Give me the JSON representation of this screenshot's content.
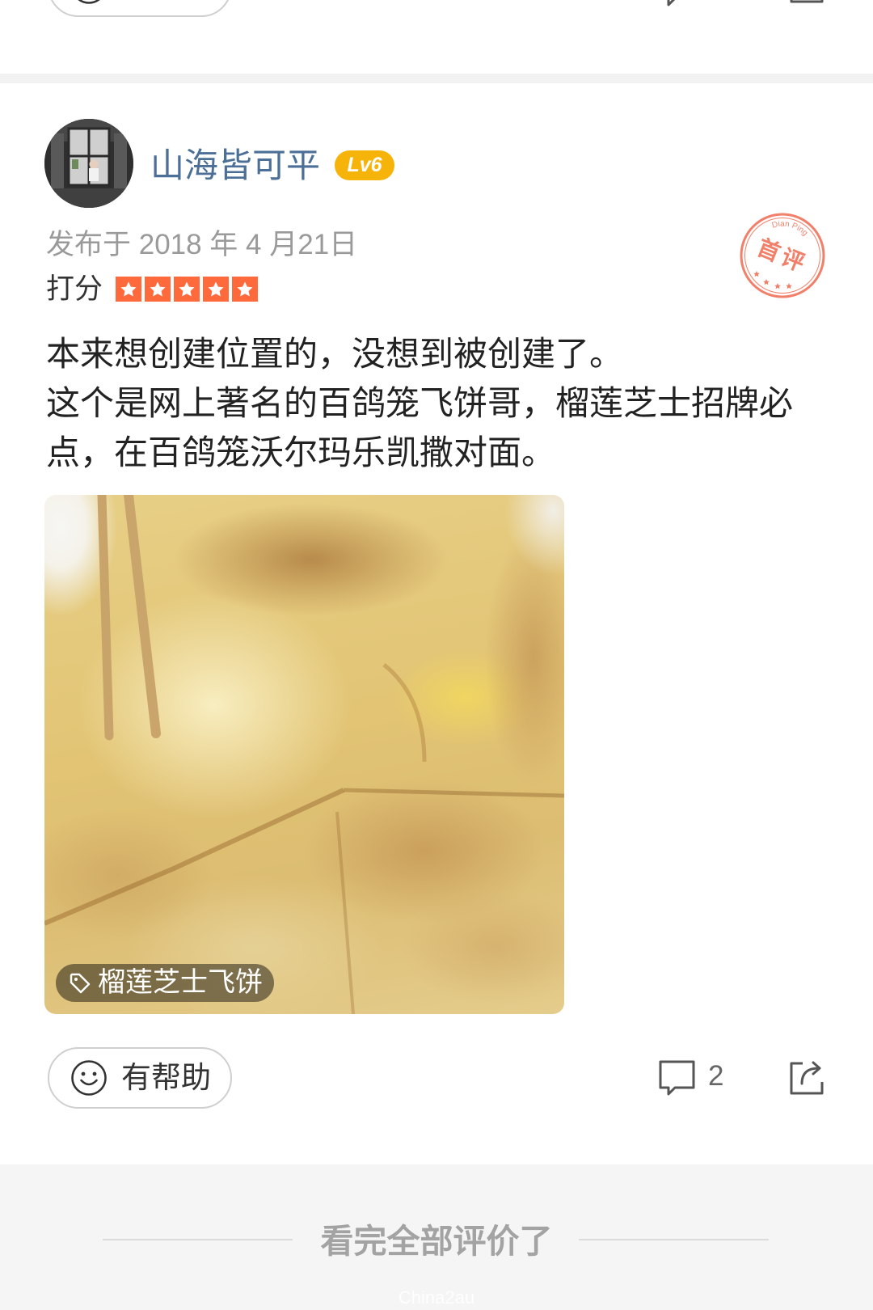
{
  "previous_review": {
    "actions": {
      "helpful_icon": "smiley-icon",
      "comment_icon": "comment-icon",
      "share_icon": "share-icon"
    }
  },
  "review": {
    "author": {
      "name": "山海皆可平",
      "level": "Lv6"
    },
    "published": "发布于 2018 年 4 月21日",
    "rating_label": "打分",
    "rating": 5,
    "rating_max": 5,
    "stamp": {
      "text": "首评",
      "arc_text": "Dian Ping"
    },
    "text_lines": [
      "本来想创建位置的，没想到被创建了。",
      "这个是网上著名的百鸽笼飞饼哥，榴莲芝士招牌必",
      "点，在百鸽笼沃尔玛乐凯撒对面。"
    ],
    "photo": {
      "tag_icon": "tag-icon",
      "tag": "榴莲芝士飞饼"
    },
    "actions": {
      "helpful_icon": "smiley-icon",
      "helpful_label": "有帮助",
      "comment_icon": "comment-icon",
      "comment_count": "2",
      "share_icon": "share-icon"
    }
  },
  "footer": {
    "end_text": "看完全部评价了",
    "watermark": "China2au"
  },
  "colors": {
    "username": "#4b6f96",
    "badge": "#f6b40b",
    "star": "#ff6a3d",
    "stamp": "#ee6a4f",
    "divider": "#f2f2f2",
    "footer_bg": "#f5f5f5"
  }
}
